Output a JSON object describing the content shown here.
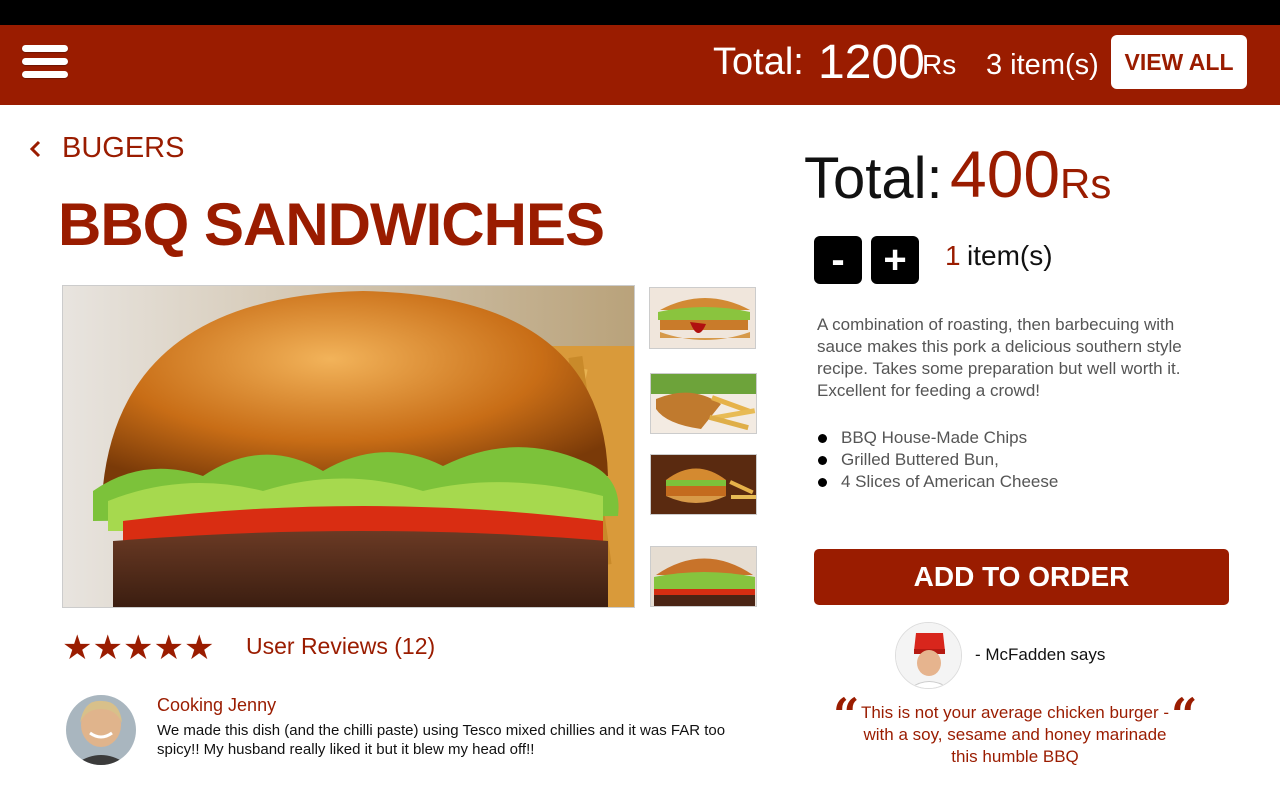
{
  "header": {
    "total_label": "Total:",
    "total_value": "1200",
    "total_unit": "Rs",
    "items_text": "3 item(s)",
    "view_all_label": "VIEW ALL"
  },
  "breadcrumb": {
    "label": "BUGERS"
  },
  "product": {
    "title": "BBQ SANDWICHES",
    "rating": 5,
    "reviews_label": "User Reviews (12)",
    "total_label": "Total:",
    "total_value": "400",
    "total_unit": "Rs",
    "decrement_label": "-",
    "increment_label": "+",
    "quantity": "1",
    "quantity_suffix": "item(s)",
    "description": "A combination of roasting, then barbecuing with sauce makes this pork a delicious southern style recipe. Takes some preparation but well worth it. Excellent for feeding a crowd!",
    "ingredients": [
      "BBQ House-Made Chips",
      "Grilled Buttered Bun,",
      "4 Slices of American Cheese"
    ],
    "add_to_order_label": "ADD TO ORDER"
  },
  "review": {
    "author": "Cooking Jenny",
    "text": "We made this dish (and the chilli paste) using Tesco mixed chillies and it was FAR too spicy!! My husband really liked it but it blew my head off!!"
  },
  "chef": {
    "says": "- McFadden says",
    "quote": "This is not your average chicken burger - with a soy, sesame and honey marinade this humble BBQ"
  },
  "colors": {
    "brand": "#9a1c00",
    "status_bar": "#000000",
    "qty_button": "#000000"
  }
}
